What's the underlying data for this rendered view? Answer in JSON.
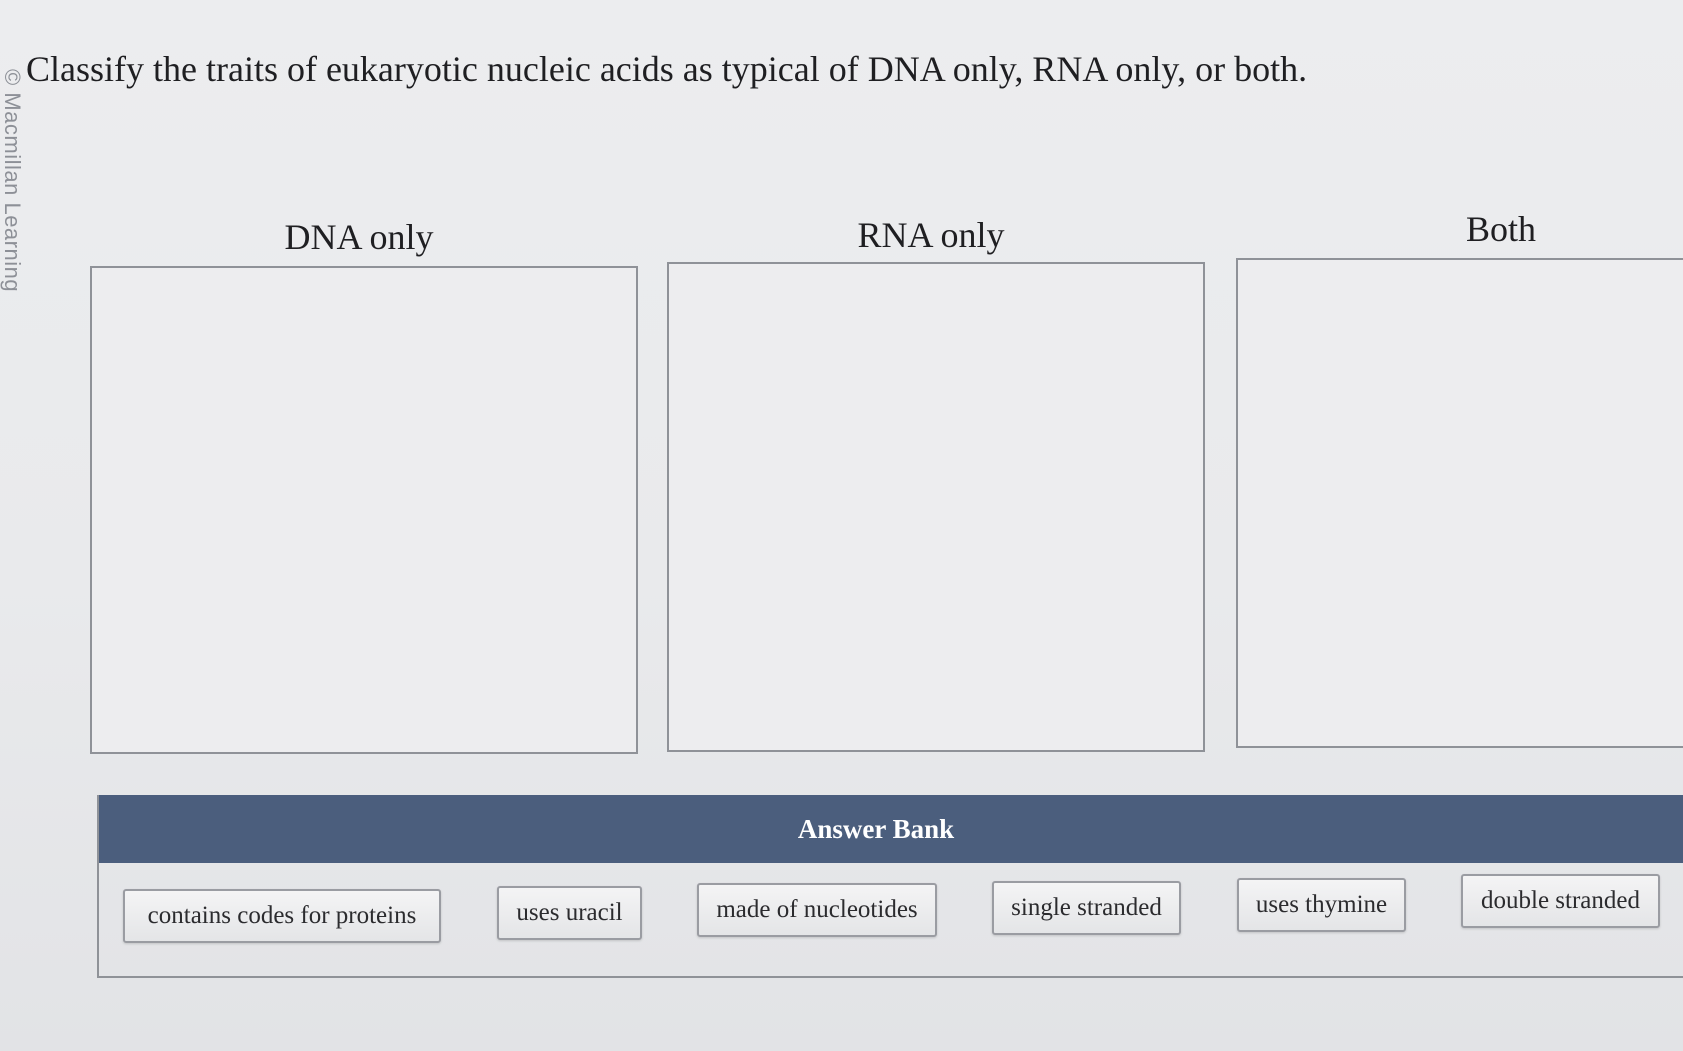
{
  "watermark": "© Macmillan Learning",
  "question": "Classify the traits of eukaryotic nucleic acids as typical of DNA only, RNA only, or both.",
  "categories": [
    {
      "label": "DNA only"
    },
    {
      "label": "RNA only"
    },
    {
      "label": "Both"
    }
  ],
  "answer_bank": {
    "title": "Answer Bank",
    "items": [
      "contains codes for proteins",
      "uses uracil",
      "made of nucleotides",
      "single stranded",
      "uses thymine",
      "double stranded"
    ]
  }
}
